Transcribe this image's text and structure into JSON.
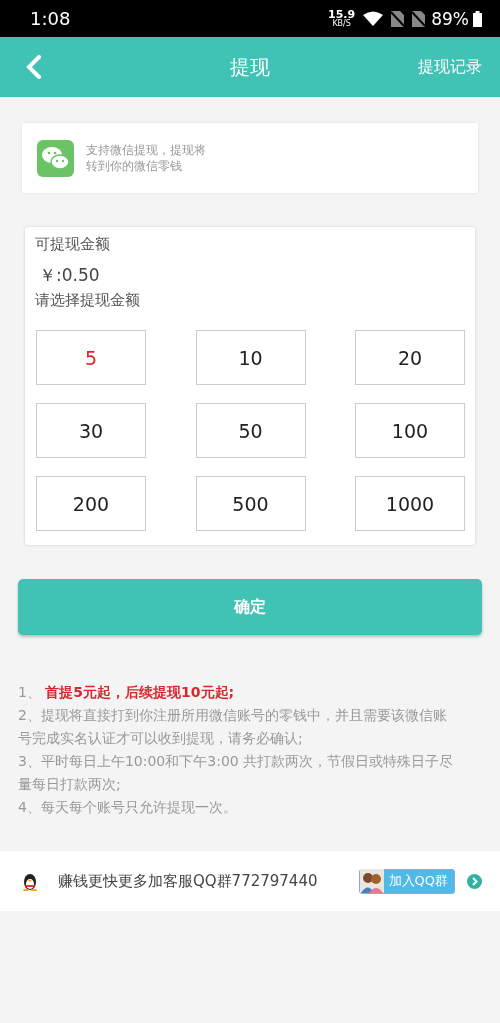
{
  "status_bar": {
    "time": "1:08",
    "speed": "15.9",
    "speed_unit": "KB/S",
    "battery": "89%"
  },
  "header": {
    "title": "提现",
    "action": "提现记录"
  },
  "wechat_notice": {
    "lines": [
      "支持微信提现，提现将",
      "转到你的微信零钱"
    ]
  },
  "balance": {
    "label": "可提现金额",
    "amount": "￥:0.50",
    "prompt": "请选择提现金额"
  },
  "amounts": [
    {
      "label": "5",
      "selected": true
    },
    {
      "label": "10",
      "selected": false
    },
    {
      "label": "20",
      "selected": false
    },
    {
      "label": "30",
      "selected": false
    },
    {
      "label": "50",
      "selected": false
    },
    {
      "label": "100",
      "selected": false
    },
    {
      "label": "200",
      "selected": false
    },
    {
      "label": "500",
      "selected": false
    },
    {
      "label": "1000",
      "selected": false
    }
  ],
  "confirm_button": "确定",
  "notes": [
    {
      "number": "1、 ",
      "text": "首提5元起，后续提现10元起;",
      "highlight": true
    },
    {
      "number": "2、",
      "text": "提现将直接打到你注册所用微信账号的零钱中，并且需要该微信账号完成实名认证才可以收到提现，请务必确认;",
      "highlight": false
    },
    {
      "number": "3、",
      "text": "平时每日上午10:00和下午3:00 共打款两次，节假日或特殊日子尽量每日打款两次;",
      "highlight": false
    },
    {
      "number": "4、",
      "text": "每天每个账号只允许提现一次。",
      "highlight": false
    }
  ],
  "qq_bar": {
    "text": "赚钱更快更多加客服QQ群772797440",
    "button": "加入QQ群"
  }
}
